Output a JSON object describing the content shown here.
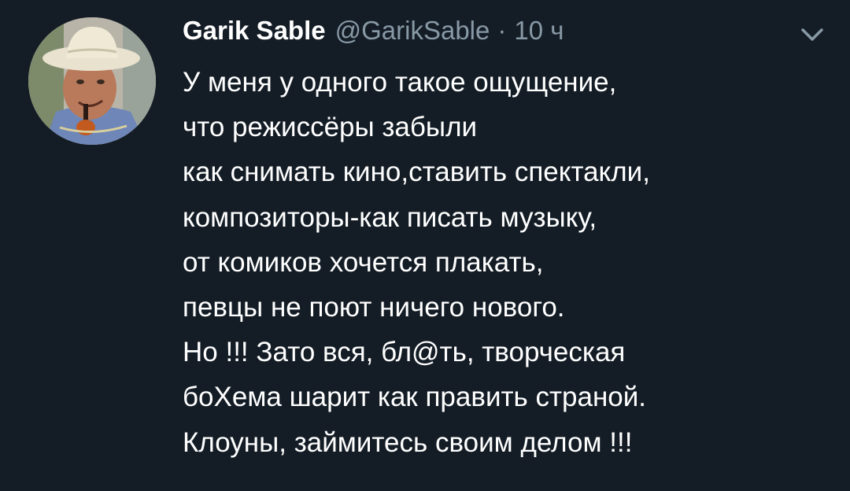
{
  "tweet": {
    "author_name": "Garik Sable",
    "handle": "@GarikSable",
    "separator": "·",
    "time": "10 ч",
    "avatar_icon": "user-avatar",
    "menu_icon": "chevron-down-icon",
    "lines": [
      "У меня у одного такое ощущение,",
      "что режиссёры забыли",
      "как снимать кино,ставить спектакли,",
      "композиторы-как писать музыку,",
      "от комиков хочется плакать,",
      "певцы не поют ничего нового.",
      "Но !!! Зато вся, бл@ть, творческая",
      "боХема шарит как править страной.",
      "Клоуны, займитесь своим делом !!!"
    ]
  },
  "colors": {
    "background": "#141d26",
    "text": "#ffffff",
    "secondary_text": "#8899a6"
  }
}
